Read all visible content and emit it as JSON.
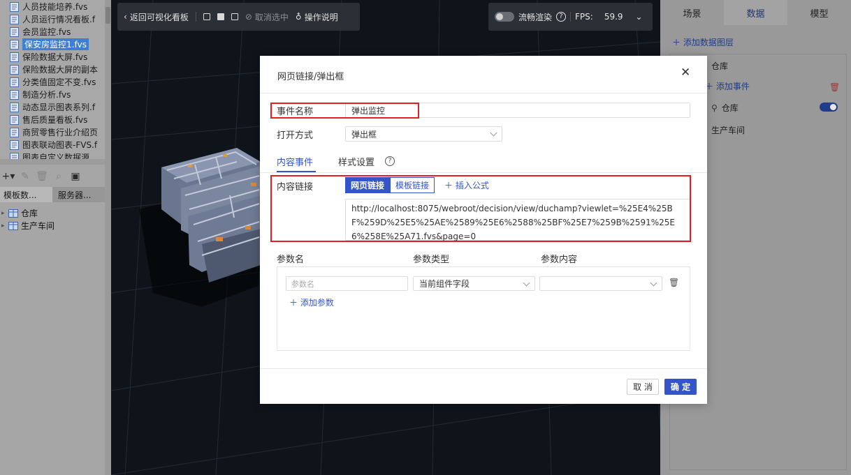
{
  "file_list": [
    {
      "name": "人员技能培养.fvs",
      "selected": false
    },
    {
      "name": "人员运行情况看板.f",
      "selected": false
    },
    {
      "name": "会员监控.fvs",
      "selected": false
    },
    {
      "name": "保安房监控1.fvs",
      "selected": true
    },
    {
      "name": "保险数据大屏.fvs",
      "selected": false
    },
    {
      "name": "保险数据大屏的副本",
      "selected": false
    },
    {
      "name": "分类值固定不变.fvs",
      "selected": false
    },
    {
      "name": "制造分析.fvs",
      "selected": false
    },
    {
      "name": "动态显示图表系列.f",
      "selected": false
    },
    {
      "name": "售后质量看板.fvs",
      "selected": false
    },
    {
      "name": "商贸零售行业介绍页",
      "selected": false
    },
    {
      "name": "图表联动图表-FVS.f",
      "selected": false
    },
    {
      "name": "图表自定义数据源",
      "selected": false
    }
  ],
  "left_tabs": [
    "模板数...",
    "服务器..."
  ],
  "datasets": [
    "仓库",
    "生产车间"
  ],
  "viewer_toolbar": {
    "back_label": "返回可视化看板",
    "cancel_select_label": "取消选中",
    "guide_label": "操作说明"
  },
  "render_toolbar": {
    "smooth_label": "流畅渲染",
    "fps_label": "FPS:",
    "fps_value": "59.9"
  },
  "right_tabs": [
    {
      "label": "场景",
      "active": false
    },
    {
      "label": "数据",
      "active": true
    },
    {
      "label": "模型",
      "active": false
    }
  ],
  "right_panel": {
    "add_layer": "＋ 添加数据图层",
    "layer_name": "仓库",
    "add_event": "＋ 添加事件",
    "event_item": "仓库",
    "second_layer": "生产车间"
  },
  "modal": {
    "title": "网页链接/弹出框",
    "event_name_label": "事件名称",
    "event_name_value": "弹出监控",
    "open_mode_label": "打开方式",
    "open_mode_value": "弹出框",
    "tabs": [
      "内容事件",
      "样式设置"
    ],
    "content_link_label": "内容链接",
    "segments": [
      "网页链接",
      "模板链接"
    ],
    "insert_formula": "＋ 插入公式",
    "url": "http://localhost:8075/webroot/decision/view/duchamp?viewlet=%25E4%25BF%259D%25E5%25AE%2589%25E6%2588%25BF%25E7%259B%2591%25E6%258E%25A71.fvs&page=0",
    "param_headers": [
      "参数名",
      "参数类型",
      "参数内容"
    ],
    "param_name_placeholder": "参数名",
    "param_type_value": "当前组件字段",
    "param_content_value": "",
    "add_param": "＋ 添加参数",
    "cancel_label": "取 消",
    "ok_label": "确 定"
  },
  "colors": {
    "accent": "#3355c9",
    "highlight_box": "#e02020",
    "viewport_bg": "#0f141a"
  }
}
